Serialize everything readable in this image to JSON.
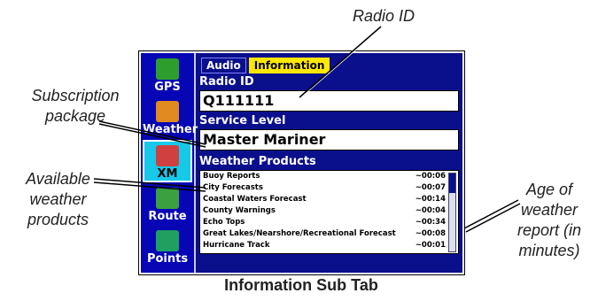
{
  "callouts": {
    "radio_id": "Radio ID",
    "subscription": [
      "Subscription",
      "package"
    ],
    "available": [
      "Available",
      "weather",
      "products"
    ],
    "age": [
      "Age of",
      "weather",
      "report (in",
      "minutes)"
    ]
  },
  "caption": "Information Sub Tab",
  "sidebar": {
    "items": [
      {
        "label": "GPS",
        "icon": "satellite-icon",
        "color": "#2d9e2d"
      },
      {
        "label": "Weather",
        "icon": "weather-icon",
        "color": "#e08a20"
      },
      {
        "label": "XM",
        "icon": "xm-radio-icon",
        "color": "#d04040"
      },
      {
        "label": "Route",
        "icon": "route-icon",
        "color": "#3aa040"
      },
      {
        "label": "Points",
        "icon": "points-icon",
        "color": "#20a060"
      }
    ]
  },
  "tabs": [
    {
      "label": "Audio",
      "active": false
    },
    {
      "label": "Information",
      "active": true
    }
  ],
  "radio_id": {
    "label": "Radio ID",
    "value": "Q111111"
  },
  "service_level": {
    "label": "Service Level",
    "value": "Master Mariner"
  },
  "weather_products": {
    "label": "Weather Products",
    "rows": [
      {
        "name": "Buoy Reports",
        "age": "~00:06"
      },
      {
        "name": "City Forecasts",
        "age": "~00:07"
      },
      {
        "name": "Coastal Waters Forecast",
        "age": "~00:14"
      },
      {
        "name": "County Warnings",
        "age": "~00:04"
      },
      {
        "name": "Echo Tops",
        "age": "~00:34"
      },
      {
        "name": "Great Lakes/Nearshore/Recreational Forecast",
        "age": "~00:08"
      },
      {
        "name": "Hurricane Track",
        "age": "~00:01"
      }
    ]
  }
}
